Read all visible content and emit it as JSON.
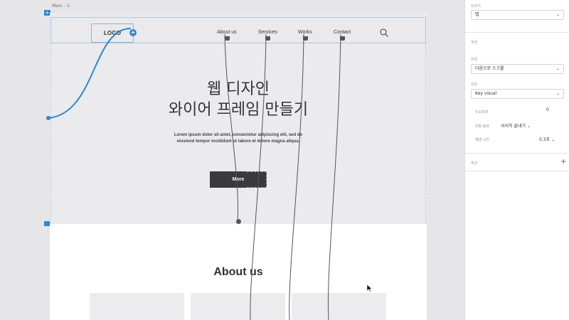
{
  "artboard": {
    "label": "Main – 1"
  },
  "header": {
    "logo": "LOGO",
    "nav": [
      "About us",
      "Services",
      "Works",
      "Contact"
    ],
    "search_icon": "search-icon"
  },
  "hero": {
    "title_line1": "웹 디자인",
    "title_line2": "와이어 프레임 만들기",
    "desc_line1": "Lorem ipsum dolor sit amet, consectetur adipiscing elit, sed do",
    "desc_line2": "eiusmod tempor incididunt ut labore et dolore magna aliqua.",
    "button": "More"
  },
  "about": {
    "title": "About us"
  },
  "panel": {
    "trigger_label": "트리거",
    "trigger_value": "탭",
    "action_section": "액션",
    "type_label": "유형",
    "type_value": "다음으로 스크롤",
    "target_label": "대상",
    "target_value": "Key visual",
    "offset_label": "Y-오프셋",
    "offset_value": "0",
    "easing_label": "이징 효과",
    "easing_value": "서서히 끝내기",
    "duration_label": "재생 시간",
    "duration_value": "0.3초",
    "actions_label": "액션",
    "add_icon": "plus-icon"
  },
  "colors": {
    "accent": "#2f86d0",
    "wire": "#555555",
    "button": "#3a3a3c"
  }
}
